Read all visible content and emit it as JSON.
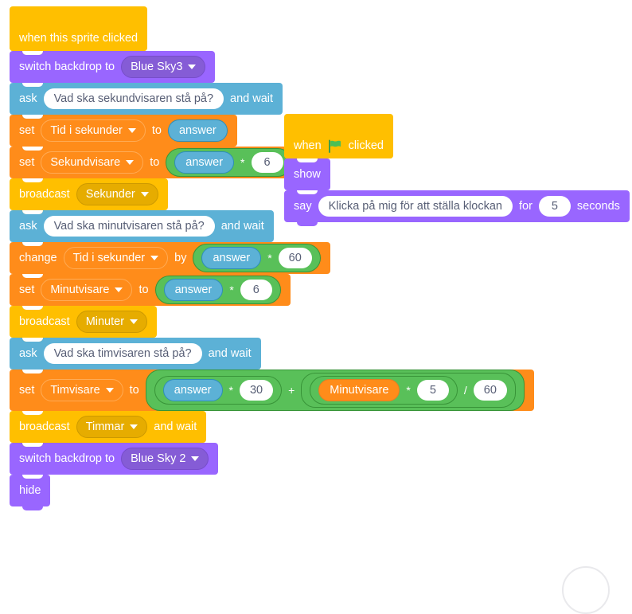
{
  "scripts": [
    {
      "name": "sprite-clicked-script",
      "blocks": {
        "hat_label": "when this sprite clicked",
        "switch_backdrop_label": "switch backdrop to",
        "backdrop_1": "Blue Sky3",
        "ask_label": "ask",
        "and_wait_label": "and wait",
        "question_seconds": "Vad ska sekundvisaren stå på?",
        "set_label": "set",
        "to_label": "to",
        "var_tid": "Tid i sekunder",
        "answer_label": "answer",
        "var_sekundvisare": "Sekundvisare",
        "mult_symbol": "*",
        "num_6a": "6",
        "broadcast_label": "broadcast",
        "msg_sekunder": "Sekunder",
        "question_minutes": "Vad ska minutvisaren stå på?",
        "change_label": "change",
        "by_label": "by",
        "num_60a": "60",
        "var_minutvisare": "Minutvisare",
        "num_6b": "6",
        "msg_minuter": "Minuter",
        "question_hours": "Vad ska timvisaren stå på?",
        "var_timvisare": "Timvisare",
        "num_30": "30",
        "plus_symbol": "+",
        "var_minutvisare_rep": "Minutvisare",
        "num_5": "5",
        "div_symbol": "/",
        "num_60b": "60",
        "msg_timmar": "Timmar",
        "broadcast_and_wait_label": "and wait",
        "backdrop_2": "Blue Sky 2",
        "hide_label": "hide"
      }
    },
    {
      "name": "flag-clicked-script",
      "blocks": {
        "when_label": "when",
        "clicked_label": "clicked",
        "flag_icon": "green-flag-icon",
        "show_label": "show",
        "say_label": "say",
        "say_text": "Klicka på mig för att ställa klockan",
        "for_label": "for",
        "num_seconds": "5",
        "seconds_label": "seconds"
      }
    }
  ],
  "colors": {
    "events": "#FFBF00",
    "looks": "#9966FF",
    "sensing": "#5CB1D6",
    "variables": "#FF8C1A",
    "operators": "#59C059",
    "input_text": "#575E75",
    "flag_green": "#4CBF56"
  }
}
